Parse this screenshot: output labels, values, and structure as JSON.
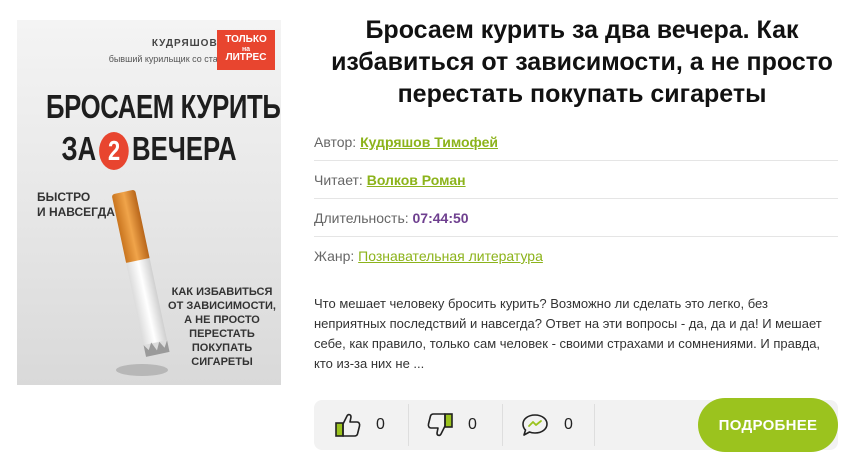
{
  "cover": {
    "author_line": "КУДРЯШОВ Т.,",
    "author_sub": "бывший курильщик со стажем",
    "badge": {
      "line1": "ТОЛЬКО",
      "line2": "на",
      "line3": "ЛИТРЕС"
    },
    "title_line1": "БРОСАЕМ КУРИТЬ",
    "title_line2_a": "ЗА",
    "title_number": "2",
    "title_line2_b": "ВЕЧЕРА",
    "subtitle": [
      "БЫСТРО",
      "И НАВСЕГДА"
    ],
    "bottom_text": [
      "КАК ИЗБАВИТЬСЯ",
      "ОТ ЗАВИСИМОСТИ,",
      "А НЕ ПРОСТО",
      "ПЕРЕСТАТЬ",
      "ПОКУПАТЬ",
      "СИГАРЕТЫ"
    ],
    "accent_color": "#e8452f"
  },
  "book": {
    "title": "Бросаем курить за два вечера. Как избавиться от зависимости, а не просто перестать покупать сигареты",
    "author_label": "Автор:",
    "author": "Кудряшов Тимофей",
    "reader_label": "Читает:",
    "reader": "Волков Роман",
    "duration_label": "Длительность:",
    "duration": "07:44:50",
    "genre_label": "Жанр:",
    "genre": "Познавательная литература",
    "description": "Что мешает человеку бросить курить? Возможно ли сделать это легко, без неприятных последствий и навсегда? Ответ на эти вопросы - да, да и да! И мешает себе, как правило, только сам человек - своими страхами и сомнениями. И правда, кто из-за них не ..."
  },
  "actions": {
    "likes": "0",
    "dislikes": "0",
    "comments": "0",
    "more_label": "ПОДРОБНЕЕ",
    "icons": {
      "like": "thumbs-up-icon",
      "dislike": "thumbs-down-icon",
      "comment": "comment-icon"
    }
  },
  "colors": {
    "accent_green": "#9bc31e",
    "link_green": "#8cb31b",
    "duration_purple": "#6e3f8f",
    "icon_green": "#9bc31e"
  }
}
